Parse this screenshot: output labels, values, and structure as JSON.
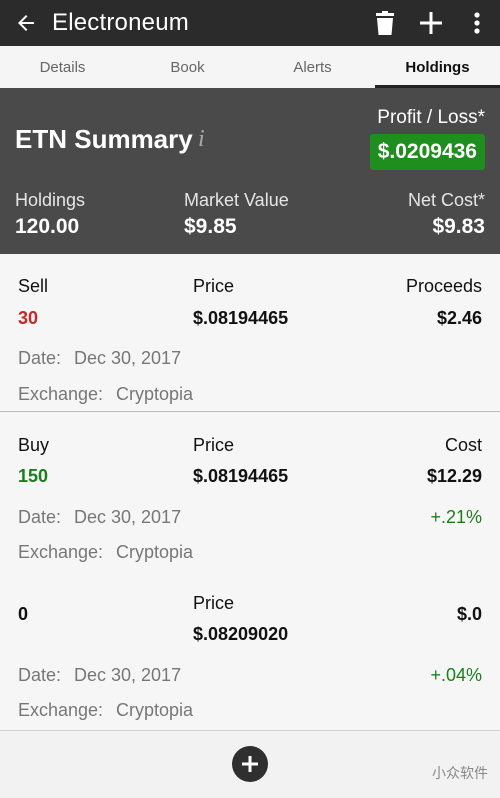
{
  "appbar": {
    "title": "Electroneum"
  },
  "tabs": [
    "Details",
    "Book",
    "Alerts",
    "Holdings"
  ],
  "summary": {
    "title": "ETN Summary",
    "info_glyph": "i",
    "profit_loss_label": "Profit / Loss*",
    "profit_loss_value": "$.0209436",
    "holdings_label": "Holdings",
    "holdings_value": "120.00",
    "market_value_label": "Market Value",
    "market_value_value": "$9.85",
    "net_cost_label": "Net Cost*",
    "net_cost_value": "$9.83"
  },
  "transactions": [
    {
      "type": "Sell",
      "qty": "30",
      "price_label": "Price",
      "price": "$.08194465",
      "amount_label": "Proceeds",
      "amount": "$2.46",
      "date_label": "Date:",
      "date": "Dec 30, 2017",
      "exchange_label": "Exchange:",
      "exchange": "Cryptopia"
    },
    {
      "type": "Buy",
      "qty": "150",
      "price_label": "Price",
      "price": "$.08194465",
      "amount_label": "Cost",
      "amount": "$12.29",
      "change": "+.21%",
      "date_label": "Date:",
      "date": "Dec 30, 2017",
      "exchange_label": "Exchange:",
      "exchange": "Cryptopia"
    },
    {
      "qty": "0",
      "price_label": "Price",
      "price": "$.08209020",
      "amount": "$.0",
      "change": "+.04%",
      "date_label": "Date:",
      "date": "Dec 30, 2017",
      "exchange_label": "Exchange:",
      "exchange": "Cryptopia"
    }
  ],
  "watermark": "小众软件",
  "colors": {
    "appbar": "#2b2b2b",
    "summary": "#4a4a4a",
    "profit": "#1e8e1e",
    "sell": "#c62828",
    "buy": "#1b7f1b"
  }
}
